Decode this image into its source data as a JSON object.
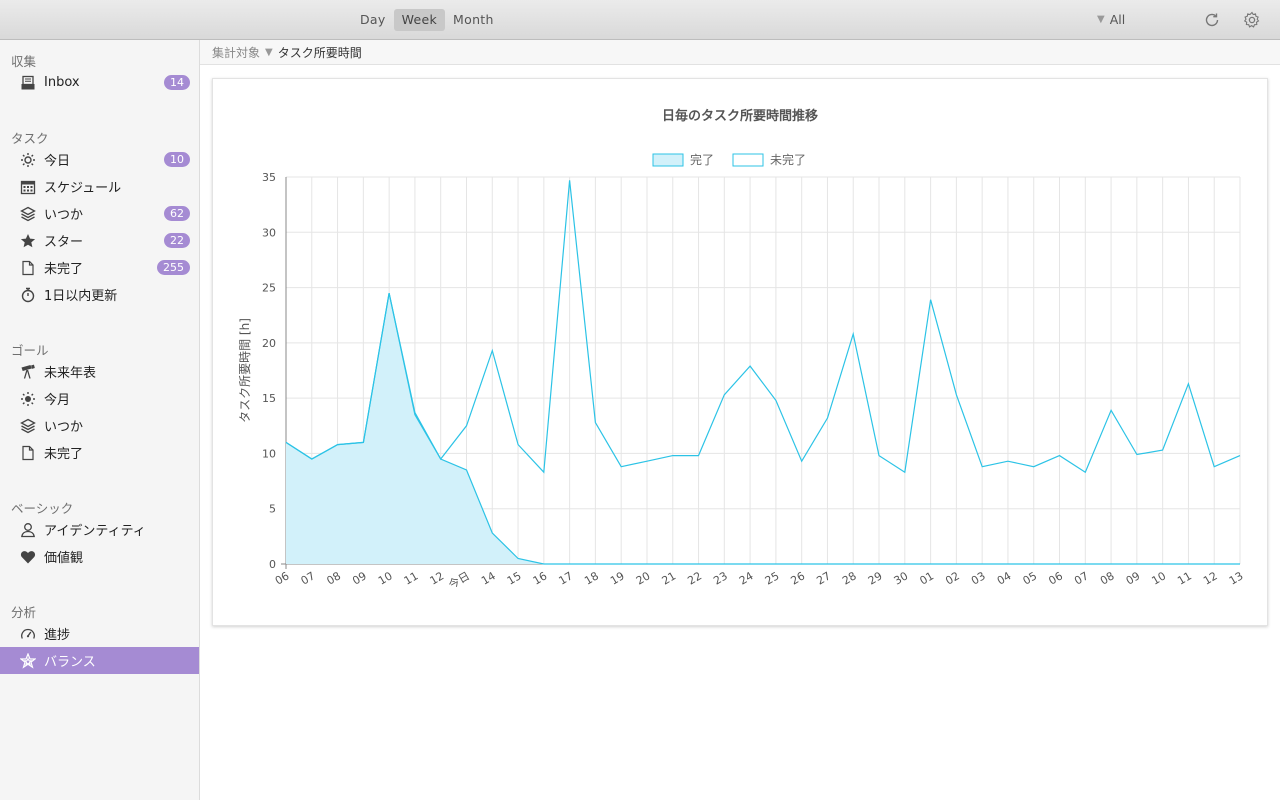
{
  "toolbar": {
    "periods": [
      {
        "label": "Day",
        "active": false
      },
      {
        "label": "Week",
        "active": true
      },
      {
        "label": "Month",
        "active": false
      }
    ],
    "filter_label": "All",
    "refresh_icon": "refresh-icon",
    "settings_icon": "gear-icon"
  },
  "sidebar": {
    "sections": [
      {
        "title": "収集",
        "items": [
          {
            "label": "Inbox",
            "icon": "inbox-icon",
            "badge": "14"
          }
        ]
      },
      {
        "title": "タスク",
        "items": [
          {
            "label": "今日",
            "icon": "sun-icon",
            "badge": "10"
          },
          {
            "label": "スケジュール",
            "icon": "calendar-icon",
            "badge": ""
          },
          {
            "label": "いつか",
            "icon": "layers-icon",
            "badge": "62"
          },
          {
            "label": "スター",
            "icon": "star-icon",
            "badge": "22"
          },
          {
            "label": "未完了",
            "icon": "document-icon",
            "badge": "255"
          },
          {
            "label": "1日以内更新",
            "icon": "stopwatch-icon",
            "badge": ""
          }
        ]
      },
      {
        "title": "ゴール",
        "items": [
          {
            "label": "未来年表",
            "icon": "telescope-icon",
            "badge": ""
          },
          {
            "label": "今月",
            "icon": "sun-icon",
            "badge": ""
          },
          {
            "label": "いつか",
            "icon": "layers-icon",
            "badge": ""
          },
          {
            "label": "未完了",
            "icon": "document-icon",
            "badge": ""
          }
        ]
      },
      {
        "title": "ベーシック",
        "items": [
          {
            "label": "アイデンティティ",
            "icon": "person-icon",
            "badge": ""
          },
          {
            "label": "価値観",
            "icon": "heart-icon",
            "badge": ""
          }
        ]
      },
      {
        "title": "分析",
        "items": [
          {
            "label": "進捗",
            "icon": "gauge-icon",
            "badge": ""
          },
          {
            "label": "バランス",
            "icon": "radar-icon",
            "badge": "",
            "active": true
          }
        ]
      }
    ]
  },
  "breadcrumb": {
    "label": "集計対象",
    "value": "タスク所要時間"
  },
  "colors": {
    "accent": "#a58bd3",
    "line": "#2cc3e6",
    "fill": "#d2f1fa"
  },
  "chart_data": {
    "type": "area",
    "title": "日毎のタスク所要時間推移",
    "ylabel": "タスク所要時間 [h]",
    "xlabel": "",
    "ylim": [
      0,
      35
    ],
    "yticks": [
      0,
      5,
      10,
      15,
      20,
      25,
      30,
      35
    ],
    "legend_position": "top-center",
    "grid": true,
    "categories": [
      "06",
      "07",
      "08",
      "09",
      "10",
      "11",
      "12",
      "今日",
      "14",
      "15",
      "16",
      "17",
      "18",
      "19",
      "20",
      "21",
      "22",
      "23",
      "24",
      "25",
      "26",
      "27",
      "28",
      "29",
      "30",
      "01",
      "02",
      "03",
      "04",
      "05",
      "06",
      "07",
      "08",
      "09",
      "10",
      "11",
      "12",
      "13"
    ],
    "series": [
      {
        "name": "完了",
        "filled": true,
        "values": [
          11,
          9.5,
          10.8,
          11,
          24.5,
          13.5,
          9.5,
          8.5,
          2.8,
          0.5,
          0,
          0,
          0,
          0,
          0,
          0,
          0,
          0,
          0,
          0,
          0,
          0,
          0,
          0,
          0,
          0,
          0,
          0,
          0,
          0,
          0,
          0,
          0,
          0,
          0,
          0,
          0,
          0
        ]
      },
      {
        "name": "未完了",
        "filled": false,
        "values": [
          11,
          9.5,
          10.8,
          11,
          24.5,
          13.7,
          9.5,
          12.5,
          19.3,
          10.8,
          8.3,
          34.7,
          12.8,
          8.8,
          9.3,
          9.8,
          9.8,
          15.3,
          17.9,
          14.8,
          9.3,
          13.2,
          20.8,
          9.8,
          8.3,
          23.9,
          15.3,
          8.8,
          9.3,
          8.8,
          9.8,
          8.3,
          13.9,
          9.9,
          10.3,
          16.3,
          8.8,
          9.8
        ]
      }
    ]
  }
}
